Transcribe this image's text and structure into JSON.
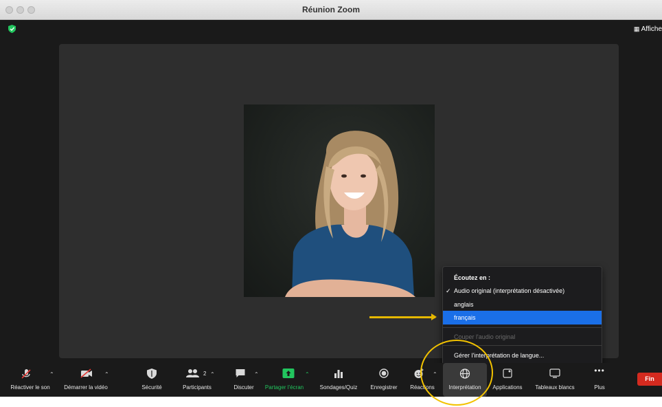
{
  "window": {
    "title": "Réunion Zoom"
  },
  "view_button": {
    "label": "Affiche"
  },
  "menu": {
    "header": "Écoutez en :",
    "items": [
      {
        "label": "Audio original (interprétation désactivée)",
        "checked": true
      },
      {
        "label": "anglais",
        "checked": false
      },
      {
        "label": "français",
        "checked": false,
        "selected": true
      }
    ],
    "mute_original": "Couper l'audio original",
    "manage": "Gérer l'interprétation de langue..."
  },
  "toolbar": {
    "unmute": "Réactiver le son",
    "start_video": "Démarrer la vidéo",
    "security": "Sécurité",
    "participants": "Participants",
    "participants_count": "2",
    "chat": "Discuter",
    "share": "Partager l'écran",
    "polls": "Sondages/Quiz",
    "record": "Enregistrer",
    "reactions": "Réactions",
    "interpretation": "Interprétation",
    "applications": "Applications",
    "whiteboards": "Tableaux blancs",
    "more": "Plus",
    "end": "Fin"
  },
  "colors": {
    "accent_blue": "#1a6fe8",
    "share_green": "#22c55e",
    "end_red": "#d42a1f",
    "annotation_yellow": "#e6b800"
  }
}
